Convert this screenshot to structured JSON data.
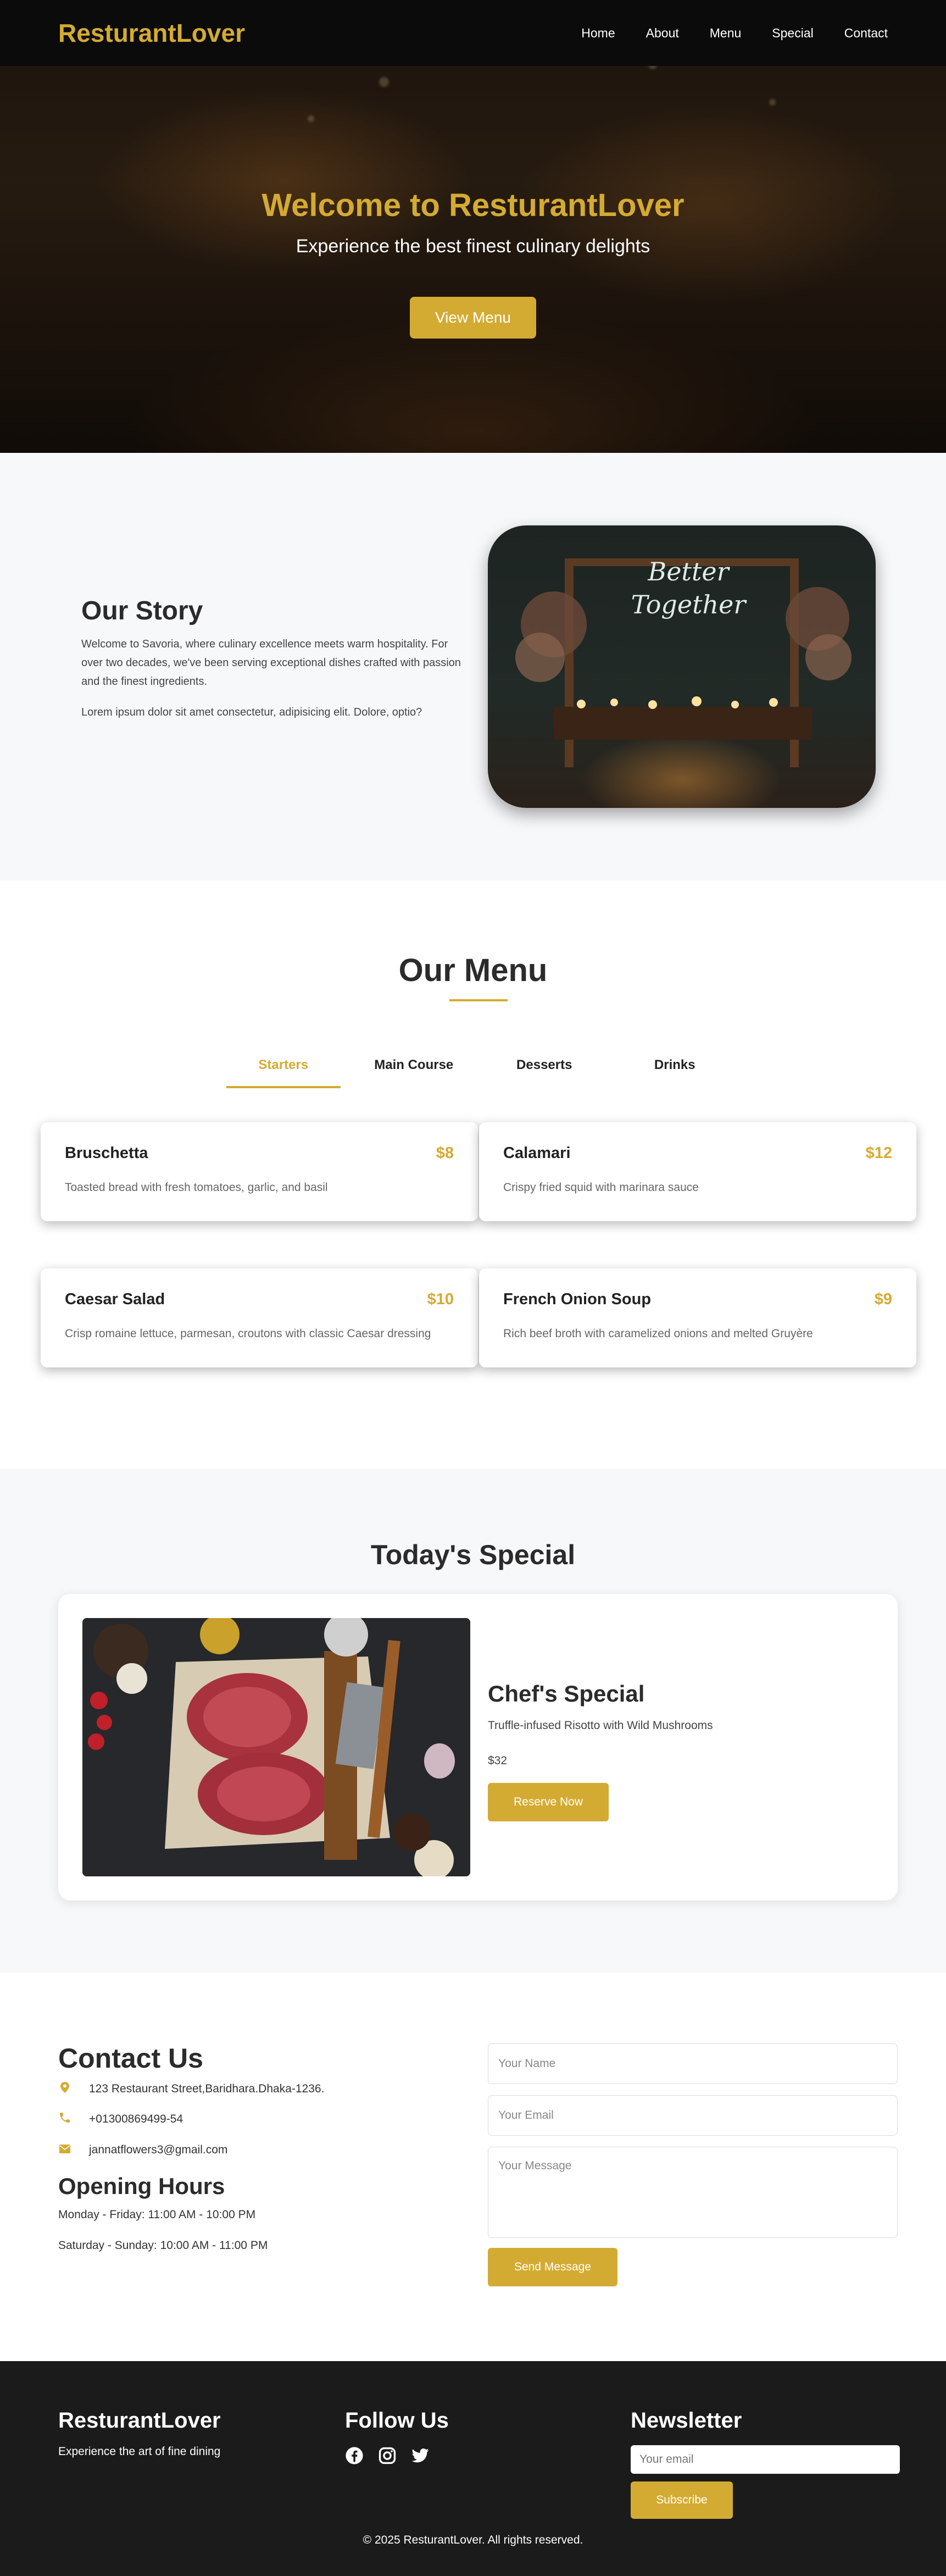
{
  "nav": {
    "brand": "ResturantLover",
    "links": [
      "Home",
      "About",
      "Menu",
      "Special",
      "Contact"
    ]
  },
  "hero": {
    "title": "Welcome to ResturantLover",
    "subtitle": "Experience the best finest culinary delights",
    "button": "View Menu"
  },
  "story": {
    "title": "Our Story",
    "paragraph1": "Welcome to Savoria, where culinary excellence meets warm hospitality. For over two decades, we've been serving exceptional dishes crafted with passion and the finest ingredients.",
    "paragraph2": "Lorem ipsum dolor sit amet consectetur, adipisicing elit. Dolore, optio?",
    "image_sign_line1": "Better",
    "image_sign_line2": "Together"
  },
  "menu": {
    "title": "Our Menu",
    "tabs": [
      "Starters",
      "Main Course",
      "Desserts",
      "Drinks"
    ],
    "active_tab": "Starters",
    "items": [
      {
        "name": "Bruschetta",
        "price": "$8",
        "desc": "Toasted bread with fresh tomatoes, garlic, and basil"
      },
      {
        "name": "Calamari",
        "price": "$12",
        "desc": "Crispy fried squid with marinara sauce"
      },
      {
        "name": "Caesar Salad",
        "price": "$10",
        "desc": "Crisp romaine lettuce, parmesan, croutons with classic Caesar dressing"
      },
      {
        "name": "French Onion Soup",
        "price": "$9",
        "desc": "Rich beef broth with caramelized onions and melted Gruyère"
      }
    ]
  },
  "special": {
    "title": "Today's Special",
    "chef_title": "Chef's Special",
    "dish": "Truffle-infused Risotto with Wild Mushrooms",
    "price": "$32",
    "button": "Reserve Now"
  },
  "contact": {
    "title": "Contact Us",
    "address": "123 Restaurant Street,Baridhara.Dhaka-1236.",
    "phone": "+01300869499-54",
    "email": "jannatflowers3@gmail.com",
    "hours_title": "Opening Hours",
    "hours_weekday": "Monday - Friday: 11:00 AM - 10:00 PM",
    "hours_weekend": "Saturday - Sunday: 10:00 AM - 11:00 PM",
    "form": {
      "name_placeholder": "Your Name",
      "email_placeholder": "Your Email",
      "message_placeholder": "Your Message",
      "button": "Send Message"
    }
  },
  "footer": {
    "brand": "ResturantLover",
    "tagline": "Experience the art of fine dining",
    "follow_title": "Follow Us",
    "social_icons": [
      "facebook-icon",
      "instagram-icon",
      "twitter-icon"
    ],
    "newsletter_title": "Newsletter",
    "newsletter_placeholder": "Your email",
    "newsletter_button": "Subscribe",
    "copyright": "© 2025 ResturantLover. All rights reserved."
  },
  "colors": {
    "accent": "#d4ab32",
    "nav_bg": "#0b0b0b",
    "footer_bg": "#1b1b1b",
    "section_bg": "#f7f8fa"
  }
}
